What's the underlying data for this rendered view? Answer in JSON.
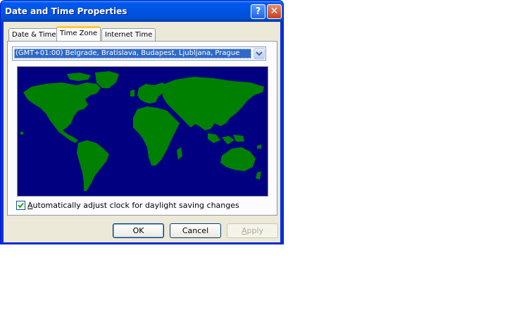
{
  "window": {
    "title": "Date and Time Properties",
    "help_glyph": "?",
    "close_glyph": "✕"
  },
  "tabs": [
    {
      "label": "Date & Time",
      "active": false
    },
    {
      "label": "Time Zone",
      "active": true
    },
    {
      "label": "Internet Time",
      "active": false
    }
  ],
  "timezone": {
    "selected": "(GMT+01:00) Belgrade, Bratislava, Budapest, Ljubljana, Prague"
  },
  "map": {
    "ocean_color": "#000080",
    "land_color": "#008000"
  },
  "dst": {
    "checked": true,
    "label_prefix": "A",
    "label_rest": "utomatically adjust clock for daylight saving changes"
  },
  "buttons": {
    "ok": "OK",
    "cancel": "Cancel",
    "apply_prefix": "A",
    "apply_rest": "pply"
  },
  "icons": {
    "help": "help-icon",
    "close": "close-icon",
    "dropdown": "chevron-down-icon",
    "checkmark": "checkmark-icon"
  }
}
